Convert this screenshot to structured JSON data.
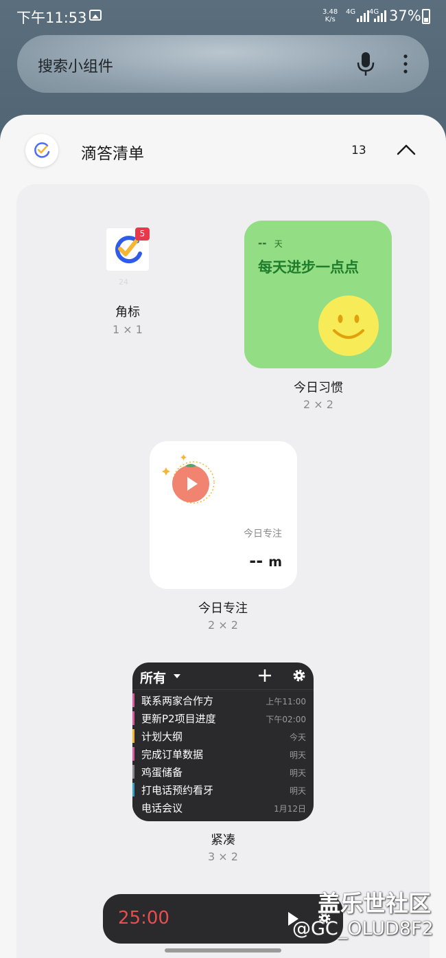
{
  "status_bar": {
    "time": "下午11:53",
    "speed_value": "3.48",
    "speed_unit": "K/s",
    "network": "4G",
    "network2": "4G",
    "battery": "37%"
  },
  "search": {
    "placeholder": "搜索小组件"
  },
  "app": {
    "name": "滴答清单",
    "widget_count": "13"
  },
  "widgets": {
    "badge": {
      "label": "角标",
      "size": "1 × 1",
      "badge_count": "5"
    },
    "habit": {
      "label": "今日习惯",
      "size": "2 × 2",
      "days": "-- ",
      "days_unit": "天",
      "motto": "每天进步一点点",
      "bg_color": "#93dd85"
    },
    "focus": {
      "label": "今日专注",
      "size": "2 × 2",
      "caption": "今日专注",
      "value": "--",
      "unit": "m"
    },
    "compact": {
      "label": "紧凑",
      "size": "3 × 2",
      "filter": "所有",
      "tasks": [
        {
          "title": "联系两家合作方",
          "time": "上午11:00",
          "color": "#e05aa0"
        },
        {
          "title": "更新P2项目进度",
          "time": "下午02:00",
          "color": "#e05aa0"
        },
        {
          "title": "计划大纲",
          "time": "今天",
          "color": "#f5b731"
        },
        {
          "title": "完成订单数据",
          "time": "明天",
          "color": "#e05aa0"
        },
        {
          "title": "鸡蛋储备",
          "time": "明天",
          "color": "#8a8a90"
        },
        {
          "title": "打电话预约看牙",
          "time": "明天",
          "color": "#3aa0c8"
        },
        {
          "title": "电话会议",
          "time": "1月12日",
          "color": "#2a2a2c"
        }
      ]
    },
    "timer": {
      "value": "25:00"
    }
  },
  "watermark": {
    "site": "盖乐世社区",
    "user": "@GC_OLUD8F2"
  }
}
